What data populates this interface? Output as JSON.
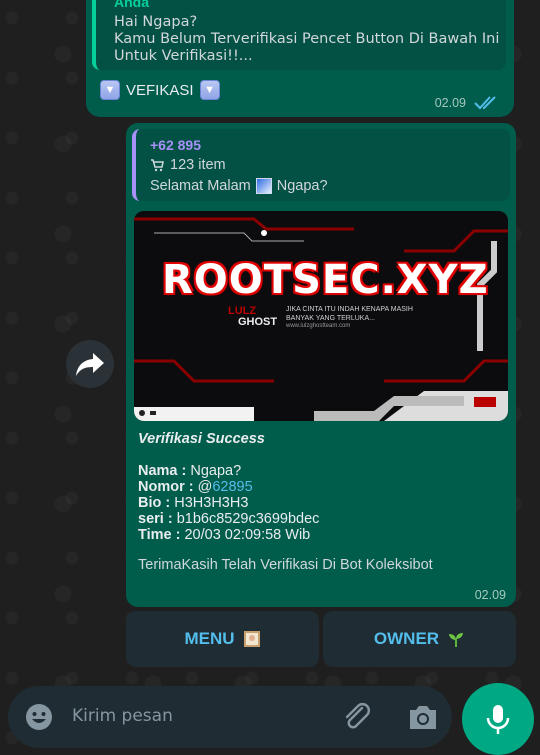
{
  "top_message": {
    "quote_author": "Anda",
    "quote_text": "Hai Ngapa?\nKamu Belum Terverifikasi Pencet Button Di Bawah Ini Untuk Verifikasi!!...",
    "body": "VEFIKASI",
    "time": "02.09",
    "status_icon": "double-check-icon"
  },
  "main_message": {
    "quote_sender": "+62 895",
    "quote_items": "123 item",
    "quote_greeting_prefix": "Selamat Malam",
    "quote_greeting_suffix": "Ngapa?",
    "banner_title": "ROOTSEC.XYZ",
    "banner_lulz": "LULZ",
    "banner_ghost": "GHOST",
    "banner_tagline": "JIKA CINTA ITU INDAH KENAPA MASIH BANYAK YANG TERLUKA...",
    "banner_site": "www.lulzghostteam.com",
    "caption_title": "Verifikasi Success",
    "fields": [
      {
        "label": "Nama :",
        "value": "Ngapa?"
      },
      {
        "label": "Nomor :",
        "value_prefix": "@",
        "value_link": "62895"
      },
      {
        "label": "Bio :",
        "value": "H3H3H3H3"
      },
      {
        "label": "seri :",
        "value": "b1b6c8529c3699bdec"
      },
      {
        "label": "Time :",
        "value": "20/03 02:09:58 Wib"
      }
    ],
    "thanks": "TerimaKasih Telah Verifikasi Di Bot Koleksibot",
    "time": "02.09"
  },
  "buttons": {
    "menu": "MENU",
    "owner": "OWNER"
  },
  "composer": {
    "placeholder": "Kirim pesan"
  },
  "colors": {
    "bubble_out": "#005c4b",
    "accent_green": "#00a884",
    "link_blue": "#53bdeb",
    "quote_purple": "#a791f7"
  }
}
